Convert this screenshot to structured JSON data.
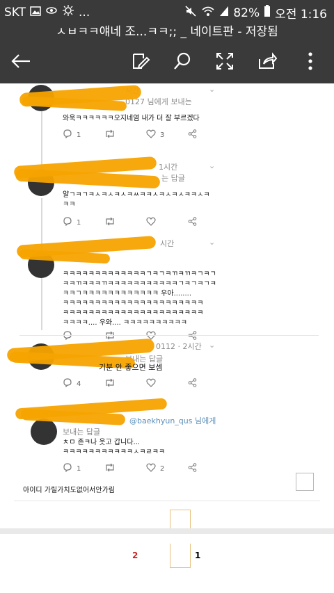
{
  "status_bar": {
    "carrier": "SKT",
    "dots": "...",
    "battery_percent": "82%",
    "time": "오전 1:16"
  },
  "title_bar": {
    "title": "ㅅㅂㅋㅋ얘네 조...ㅋㅋ;; _ 네이트판 - 저장됨"
  },
  "toolbar": {
    "icons": [
      "back-arrow-icon",
      "edit-icon",
      "search-icon",
      "fullscreen-icon",
      "share-icon",
      "more-vert-icon"
    ]
  },
  "tweets": [
    {
      "meta_time": "시간",
      "meta_reply": "0127 님에게 보내는",
      "text": "와욱ㅋㅋㅋㅋㅋㅋ오지네염 내가 더 잘 부르겠다",
      "replies": "1",
      "retweets": "",
      "likes": "3"
    },
    {
      "meta_time": "1시간",
      "meta_reply": "는 답글",
      "text": "얄ㄱㅋㄱㅋㅅㅋㅅㅋㅅㅋㅆㅋㅋㅅㅋㅅㅋㅅㅋㅋㅅㅋ\nㅋㅋ",
      "replies": "1",
      "retweets": "",
      "likes": ""
    },
    {
      "meta_time": "시간",
      "meta_reply": "",
      "text": "ㅋㅋㅋㅋㅋㅋㅋㅋㅋㅋㅋㅋㅋㄱㅋㄱㅋㄲㅋㄲㅋㄱㅋㄱ\nㅋㅋㄲㅋㅋㅋㄲㅋㅋㅋㅋㅋㅋㅋㅋㅋㅋㅋㄱㅋㄱㅋㄱㅋ\nㅋㅋㄱㅋㅋㅋㅋㅋㅋㅋㅋㅋㅋㅋㅋ 우아........\nㅋㅋㅋㅋㅋㅋㅋㅋㅋㅋㅋㅋㅋㅋㅋㅋㅋㅋㅋㅋㅋㅋ\nㅋㅋㅋㅋㅋㅋㅋㅋㅋㅋㅋㅋㅋㅋㅋㅋㅋㅋㅋㅋㅋㅋ\nㅋㅋㅋㅋ.... 우와.... ㅋㅋㅋㅋㅋㅋㅋㅋㅋㅋ",
      "replies": "",
      "retweets": "",
      "likes": ""
    },
    {
      "meta_time": "0112 · 2시간",
      "meta_reply": "보내는 답글",
      "text": "기분 안 좋으면 보셈",
      "replies": "4",
      "retweets": "",
      "likes": ""
    },
    {
      "meta_time": "",
      "meta_reply": "@baekhyun_qus 님에게",
      "meta_reply2": "보내는 답글",
      "text": "ㅊㅁ 존ㅋ나 웃고 갑니다...\nㅋㅋㅋㅋㅋㅋㅋㅋㅋㅋㅋㅅㅋㄹㅋㅋ",
      "replies": "1",
      "retweets": "",
      "likes": "2"
    }
  ],
  "caption": "아이디 가릴가치도없어서안가림",
  "pagination": {
    "prev_page": "2",
    "current_page": "1"
  },
  "colors": {
    "bar_bg": "#3a3a3a",
    "scribble": "#f6a300",
    "link": "#5b8fb9",
    "prev_page": "#c62828"
  }
}
